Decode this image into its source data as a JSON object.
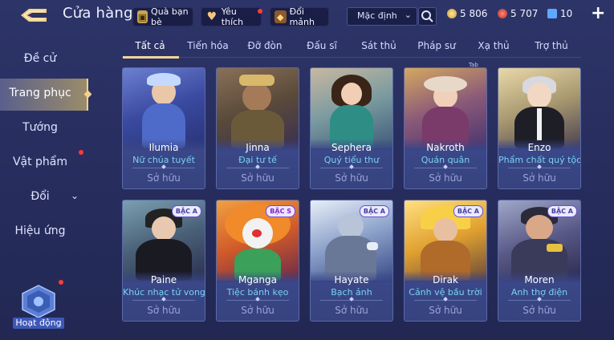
{
  "header": {
    "title": "Cửa hàng",
    "gift_label": "Quà bạn bè",
    "fav_label": "Yêu thích",
    "fragments_label": "Đổi mảnh",
    "sort_value": "Mặc định",
    "currencies": [
      {
        "name": "gold",
        "value": "5 806",
        "color": "#e9c15a"
      },
      {
        "name": "ruby",
        "value": "5 707",
        "color": "#d9493f"
      },
      {
        "name": "voucher",
        "value": "10",
        "color": "#5fa8ff"
      }
    ]
  },
  "tabs": [
    "Tất cả",
    "Tiến hóa",
    "Đỡ đòn",
    "Đấu sĩ",
    "Sát thủ",
    "Pháp sư",
    "Xạ thủ",
    "Trợ thủ"
  ],
  "tab_hint": "Tab",
  "sidebar": {
    "items": [
      "Đề cử",
      "Trang phục",
      "Tướng",
      "Vật phẩm",
      "Đổi",
      "Hiệu ứng"
    ],
    "event_label": "Hoạt động"
  },
  "cards": [
    {
      "hero": "Ilumia",
      "skin": "Nữ chúa tuyết",
      "status": "Sở hữu",
      "badge": ""
    },
    {
      "hero": "Jinna",
      "skin": "Đại tư tế",
      "status": "Sở hữu",
      "badge": ""
    },
    {
      "hero": "Sephera",
      "skin": "Quý tiểu thư",
      "status": "Sở hữu",
      "badge": ""
    },
    {
      "hero": "Nakroth",
      "skin": "Quán quân",
      "status": "Sở hữu",
      "badge": ""
    },
    {
      "hero": "Enzo",
      "skin": "Phẩm chất quý tộc",
      "status": "Sở hữu",
      "badge": ""
    },
    {
      "hero": "Paine",
      "skin": "Khúc nhạc tử vong",
      "status": "Sở hữu",
      "badge": "BẬC A"
    },
    {
      "hero": "Mganga",
      "skin": "Tiệc bánh kẹo",
      "status": "Sở hữu",
      "badge": "BẬC S"
    },
    {
      "hero": "Hayate",
      "skin": "Bạch ảnh",
      "status": "Sở hữu",
      "badge": "BẬC A"
    },
    {
      "hero": "Dirak",
      "skin": "Cảnh vệ bầu trời",
      "status": "Sở hữu",
      "badge": "BẬC A"
    },
    {
      "hero": "Moren",
      "skin": "Anh thợ điện",
      "status": "Sở hữu",
      "badge": "BẬC A"
    }
  ],
  "colors": {
    "accent": "#f1d28c",
    "skin_name": "#78d2f2",
    "card_bg": "#2f3a78"
  }
}
